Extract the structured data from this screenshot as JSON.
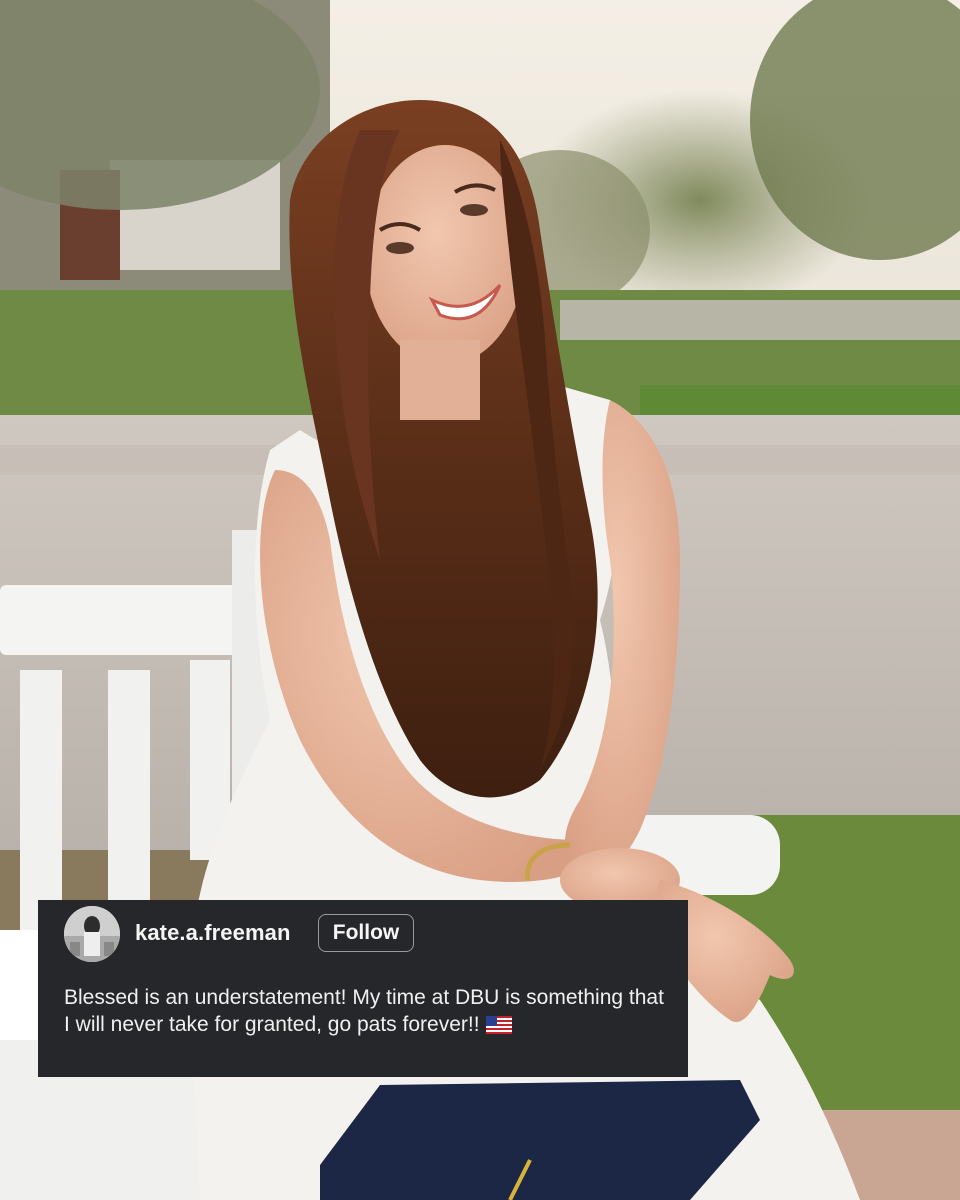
{
  "photo": {
    "description_icon": "portrait-photo"
  },
  "post": {
    "username": "kate.a.freeman",
    "follow_label": "Follow",
    "caption": "Blessed is an understatement! My time at DBU is something that I will never take for granted, go pats forever!!",
    "flag_icon": "us-flag-emoji"
  },
  "colors": {
    "card_background": "#26272b",
    "card_text": "#f5f5f5",
    "follow_border": "#9a9a9a"
  }
}
